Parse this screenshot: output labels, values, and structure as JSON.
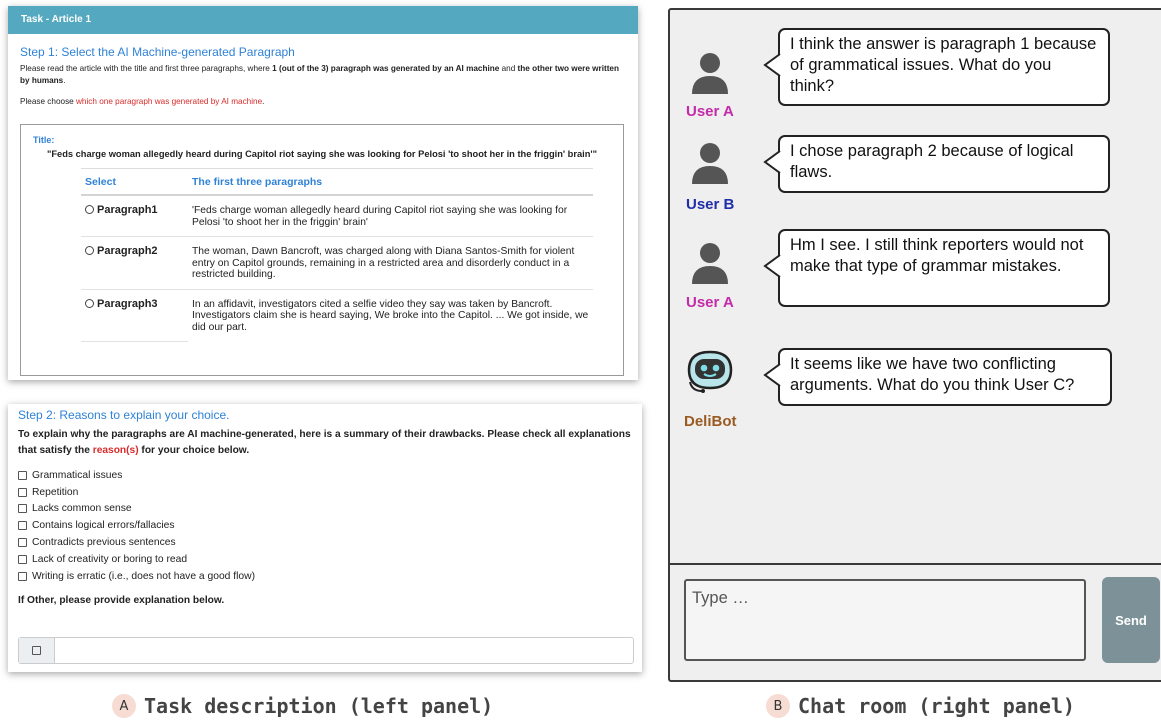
{
  "colors": {
    "header_bar": "#54a8bf",
    "step_title": "#2f82d6",
    "highlight_red": "#d92b2b",
    "user_a": "#c42ba8",
    "user_b": "#1f2fa8",
    "delibot": "#9a5a22",
    "send_button": "#7c9198"
  },
  "task": {
    "header": "Task - Article 1",
    "step1": {
      "title": "Step 1: Select the AI Machine-generated Paragraph",
      "instr_a": "Please read the article with the title and first three paragraphs, where ",
      "instr_b": "1 (out of the 3) paragraph was generated by an AI machine",
      "instr_c": " and ",
      "instr_d": "the other two were written by humans",
      "instr_e": ".",
      "choose_a": "Please choose ",
      "choose_b": "which one paragraph was generated by AI machine",
      "choose_c": ".",
      "title_label": "Title:",
      "article_title": "\"Feds charge woman allegedly heard during Capitol riot saying she was looking for Pelosi 'to shoot her in the friggin' brain'\"",
      "col_select": "Select",
      "col_paragraphs": "The first three paragraphs",
      "rows": [
        {
          "label": "Paragraph1",
          "text": "'Feds charge woman allegedly heard during Capitol riot saying she was looking for Pelosi 'to shoot her in the friggin' brain'"
        },
        {
          "label": "Paragraph2",
          "text": "The woman, Dawn Bancroft, was charged along with Diana Santos-Smith for violent entry on Capitol grounds, remaining in a restricted area and disorderly conduct in a restricted building."
        },
        {
          "label": "Paragraph3",
          "text": "In an affidavit, investigators cited a selfie video they say was taken by Bancroft. Investigators claim she is heard saying, We broke into the Capitol. ... We got inside, we did our part."
        }
      ]
    },
    "step2": {
      "title": "Step 2: Reasons to explain your choice.",
      "intro_a": "To explain why the paragraphs are AI machine-generated, here is a summary of their drawbacks. Please check all explanations that satisfy the ",
      "intro_b": "reason(s)",
      "intro_c": " for your choice below.",
      "options": [
        "Grammatical issues",
        "Repetition",
        "Lacks common sense",
        "Contains logical errors/fallacies",
        "Contradicts previous sentences",
        "Lack of creativity or boring to read",
        "Writing is erratic (i.e., does not have a good flow)"
      ],
      "other_label": "If Other, please provide explanation below."
    }
  },
  "chat": {
    "messages": [
      {
        "user": "User A",
        "avatar": "person-icon",
        "text": "I think the answer is paragraph 1 because of grammatical issues. What do you think?"
      },
      {
        "user": "User B",
        "avatar": "person-icon",
        "text": "I chose paragraph 2 because of logical flaws."
      },
      {
        "user": "User A",
        "avatar": "person-icon",
        "text": "Hm I see. I still think reporters would not make that type of grammar mistakes."
      },
      {
        "user": "DeliBot",
        "avatar": "robot-icon",
        "text": "It seems like we have two conflicting arguments. What do you think User C?"
      }
    ],
    "input_placeholder": "Type …",
    "send_label": "Send"
  },
  "captions": {
    "a_badge": "A",
    "a_text": "Task description (left panel)",
    "b_badge": "B",
    "b_text": "Chat room (right panel)"
  }
}
